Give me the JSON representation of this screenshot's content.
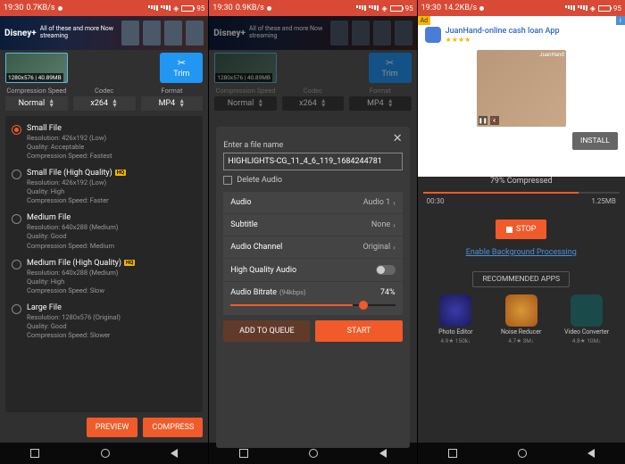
{
  "status": {
    "time": "19:30",
    "speed1": "0.7KB/s",
    "speed2": "0.9KB/s",
    "speed3": "14.2KB/s",
    "batt": "95"
  },
  "banner": {
    "logo": "Disney+",
    "text": "All of these and more\nNow streaming"
  },
  "thumb": {
    "label": "1280x576 | 40.89MB"
  },
  "trim": "Trim",
  "dd": {
    "speed_lbl": "Compression\nSpeed",
    "speed_val": "Normal",
    "codec_lbl": "Codec",
    "codec_val": "x264",
    "format_lbl": "Format",
    "format_val": "MP4"
  },
  "opts": {
    "a": {
      "title": "Small File",
      "res": "Resolution: 426x192 (Low)",
      "q": "Quality: Acceptable",
      "s": "Compression Speed: Fastest"
    },
    "b": {
      "title": "Small File (High Quality)",
      "res": "Resolution: 426x192 (Low)",
      "q": "Quality: High",
      "s": "Compression Speed: Faster"
    },
    "c": {
      "title": "Medium File",
      "res": "Resolution: 640x288 (Medium)",
      "q": "Quality: Good",
      "s": "Compression Speed: Medium"
    },
    "d": {
      "title": "Medium File (High Quality)",
      "res": "Resolution: 640x288 (Medium)",
      "q": "Quality: High",
      "s": "Compression Speed: Slow"
    },
    "e": {
      "title": "Large File",
      "res": "Resolution: 1280x576 (Original)",
      "q": "Quality: Good",
      "s": "Compression Speed: Slower"
    }
  },
  "btns": {
    "preview": "PREVIEW",
    "compress": "COMPRESS",
    "queue": "ADD TO QUEUE",
    "start": "START"
  },
  "modal": {
    "label": "Enter a file name",
    "value": "HIGHLIGHTS-CG_11_4_6_119_1684244781",
    "delete": "Delete Audio",
    "audio_lbl": "Audio",
    "audio_val": "Audio 1",
    "sub_lbl": "Subtitle",
    "sub_val": "None",
    "chan_lbl": "Audio Channel",
    "chan_val": "Original",
    "hq_lbl": "High Quality Audio",
    "bitrate_lbl": "Audio Bitrate",
    "bitrate_sub": "(94kbps)",
    "bitrate_pct": "74%"
  },
  "p3": {
    "ad_title": "JuanHand-online cash loan App",
    "ad_stars": "★★★★",
    "ad_corner": "JuanHand",
    "install": "INSTALL",
    "prog": "79% Compressed",
    "time": "00:30",
    "size": "1.25MB",
    "stop": "STOP",
    "enable": "Enable Background Processing",
    "recs_lbl": "RECOMMENDED APPS",
    "r1n": "Photo Editor",
    "r1m": "4.9★  150k↓",
    "r2n": "Noise Reducer",
    "r2m": "4.7★  3M↓",
    "r3n": "Video Converter",
    "r3m": "4.8★  10M↓"
  }
}
